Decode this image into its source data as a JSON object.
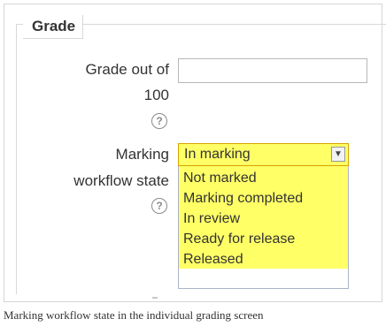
{
  "section": {
    "title": "Grade"
  },
  "grade_field": {
    "label_line1": "Grade out of",
    "label_line2": "100",
    "value": "",
    "help_icon": "question-circle-icon"
  },
  "workflow_field": {
    "label_line1": "Marking",
    "label_line2": "workflow state",
    "selected": "In marking",
    "options": [
      "Not marked",
      "Marking completed",
      "In review",
      "Ready for release",
      "Released"
    ],
    "help_icon": "question-circle-icon"
  },
  "caption": "Marking workflow state in the individual grading screen",
  "colors": {
    "highlight": "#ffff66",
    "border": "#d8d8d8"
  }
}
